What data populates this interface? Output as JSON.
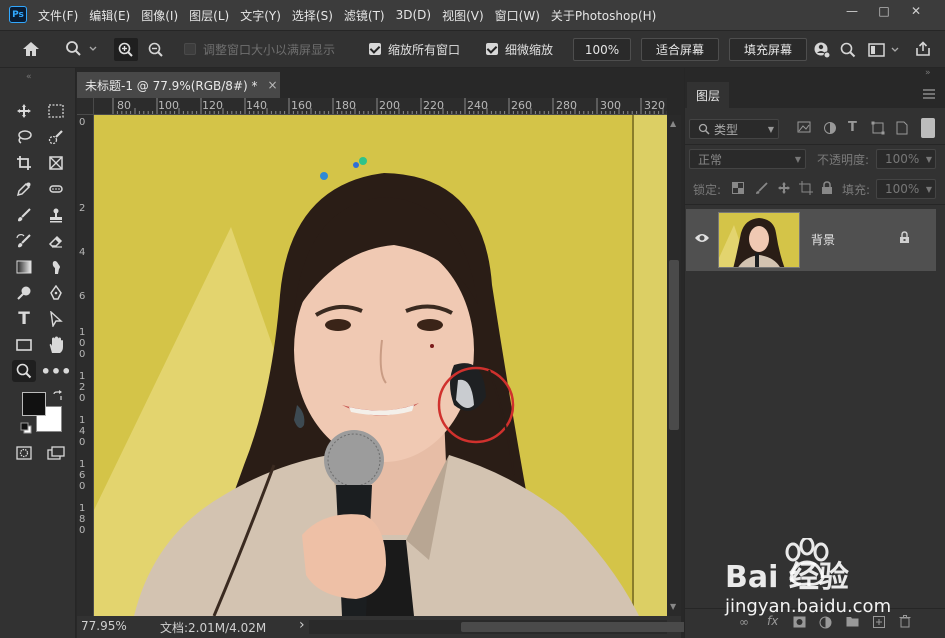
{
  "app": {
    "logo_text": "Ps"
  },
  "menubar": {
    "items": [
      "文件(F)",
      "编辑(E)",
      "图像(I)",
      "图层(L)",
      "文字(Y)",
      "选择(S)",
      "滤镜(T)",
      "3D(D)",
      "视图(V)",
      "窗口(W)",
      "关于Photoshop(H)"
    ],
    "minimize_label": "—",
    "maximize_label": "□",
    "close_label": "✕"
  },
  "options": {
    "resize_windows_label": "调整窗口大小以满屏显示",
    "zoom_all_windows_label": "缩放所有窗口",
    "scrubby_zoom_label": "细微缩放",
    "zoom_100_label": "100%",
    "fit_screen_label": "适合屏幕",
    "fill_screen_label": "填充屏幕",
    "resize_windows_checked": false,
    "zoom_all_windows_checked": true,
    "scrubby_zoom_checked": true
  },
  "document": {
    "tab_title": "未标题-1 @ 77.9%(RGB/8#) *",
    "close_label": "×",
    "zoom_level": "77.95%",
    "doc_size": "文档:2.01M/4.02M",
    "status_arrow": "›",
    "ruler_top": [
      "80",
      "100",
      "120",
      "140",
      "160",
      "180",
      "200",
      "220",
      "240",
      "260",
      "280",
      "300",
      "320"
    ],
    "ruler_left": [
      "0",
      "2",
      "4",
      "6",
      "8",
      "1 0 0",
      "1 2 0",
      "1 4 0",
      "1 6 0",
      "1 8 0"
    ]
  },
  "tools": [
    "move-icon",
    "marquee-icon",
    "lasso-icon",
    "quick-select-icon",
    "crop-icon",
    "frame-icon",
    "eyedropper-icon",
    "spot-heal-icon",
    "brush-icon",
    "stamp-icon",
    "history-brush-icon",
    "eraser-icon",
    "gradient-icon",
    "smudge-icon",
    "dodge-icon",
    "pen-icon",
    "type-icon",
    "path-select-icon",
    "rectangle-icon",
    "hand-icon",
    "zoom-icon",
    "more-icon"
  ],
  "colors": {
    "foreground": "#111111",
    "background": "#ffffff",
    "canvas_bg": "#d4c448",
    "accent_circle": "#d0312d"
  },
  "layers_panel": {
    "title": "图层",
    "filter_type": "类型",
    "blend_mode": "正常",
    "opacity_label": "不透明度:",
    "opacity_value": "100%",
    "lock_label": "锁定:",
    "fill_label": "填充:",
    "fill_value": "100%",
    "layers": [
      {
        "name": "背景",
        "visible": true,
        "locked": true
      }
    ]
  },
  "watermark": {
    "brand": "Bai 经验",
    "url": "jingyan.baidu.com"
  }
}
